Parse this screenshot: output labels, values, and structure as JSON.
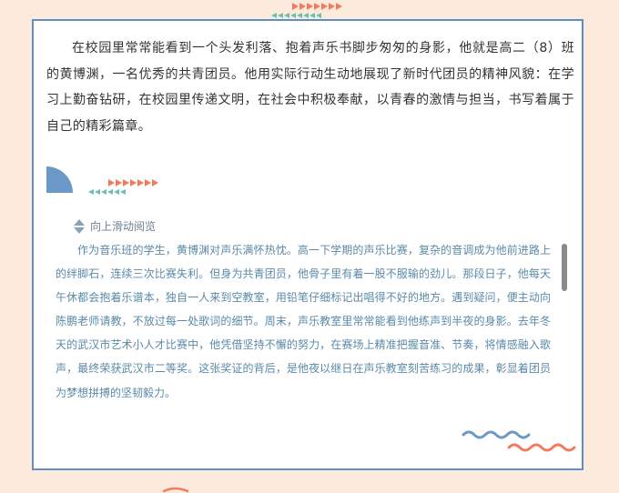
{
  "article": {
    "intro": "在校园里常常能看到一个头发利落、抱着声乐书脚步匆匆的身影，他就是高二（8）班的黄博渊，一名优秀的共青团员。他用实际行动生动地展现了新时代团员的精神风貌：在学习上勤奋钻研，在校园里传递文明，在社会中积极奉献，以青春的激情与担当，书写着属于自己的精彩篇章。",
    "scroll_hint": "向上滑动阅览",
    "scroll_text": "作为音乐班的学生，黄博渊对声乐满怀热忱。高一下学期的声乐比赛，复杂的音调成为他前进路上的绊脚石，连续三次比赛失利。但身为共青团员，他骨子里有着一股不服输的劲儿。那段日子，他每天午休都会抱着乐谱本，独自一人来到空教室，用铅笔仔细标记出唱得不好的地方。遇到疑问，便主动向陈鹏老师请教，不放过每一处歌词的细节。周末，声乐教室里常常能看到他练声到半夜的身影。去年冬天的武汉市艺术小人才比赛中，他凭借坚持不懈的努力，在赛场上精准把握音准、节奏，将情感融入歌声，最终荣获武汉市二等奖。这张奖证的背后，是他夜以继日在声乐教室刻苦练习的成果，彰显着团员为梦想拼搏的坚韧毅力。"
  },
  "icons": [
    "triangle-arrow-row-icon",
    "quarter-circle-icon",
    "scroll-up-down-icon",
    "wave-line-icon"
  ],
  "colors": {
    "background": "#fcebdc",
    "card_border": "#5f8fc2",
    "accent_orange": "#f47a5d",
    "accent_teal": "#6fbfb0",
    "accent_blue": "#6b98c6",
    "scroll_text": "#5a8aa8"
  }
}
